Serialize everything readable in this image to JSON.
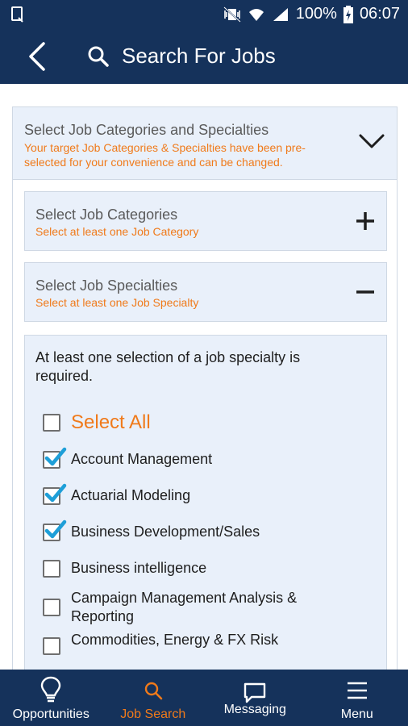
{
  "status_bar": {
    "battery": "100%",
    "time": "06:07"
  },
  "app_bar": {
    "title": "Search For Jobs"
  },
  "categories_section": {
    "title": "Select Job Categories and Specialties",
    "subtitle": "Your target Job Categories & Specialties have been pre-selected for your convenience and can be changed."
  },
  "job_categories": {
    "title": "Select Job Categories",
    "subtitle": "Select at least one Job Category"
  },
  "job_specialties": {
    "title": "Select Job Specialties",
    "subtitle": "Select at least one Job Specialty"
  },
  "specialty_list": {
    "note": "At least one selection of a job specialty is required.",
    "select_all": {
      "label": "Select All",
      "checked": false
    },
    "items": [
      {
        "label": "Account Management",
        "checked": true
      },
      {
        "label": "Actuarial Modeling",
        "checked": true
      },
      {
        "label": "Business Development/Sales",
        "checked": true
      },
      {
        "label": "Business intelligence",
        "checked": false
      },
      {
        "label": "Campaign Management Analysis & Reporting",
        "checked": false
      },
      {
        "label": "Commodities, Energy & FX Risk",
        "checked": false
      }
    ]
  },
  "bottom_nav": {
    "items": [
      {
        "label": "Opportunities",
        "icon": "lightbulb-icon",
        "active": false
      },
      {
        "label": "Job Search",
        "icon": "search-icon",
        "active": true
      },
      {
        "label": "Messaging",
        "icon": "chat-bubble-icon",
        "active": false
      },
      {
        "label": "Menu",
        "icon": "hamburger-menu-icon",
        "active": false
      }
    ]
  },
  "colors": {
    "primary": "#15325b",
    "accent": "#f07a1a",
    "panel": "#e9f0fa",
    "check": "#1e9fd8"
  }
}
